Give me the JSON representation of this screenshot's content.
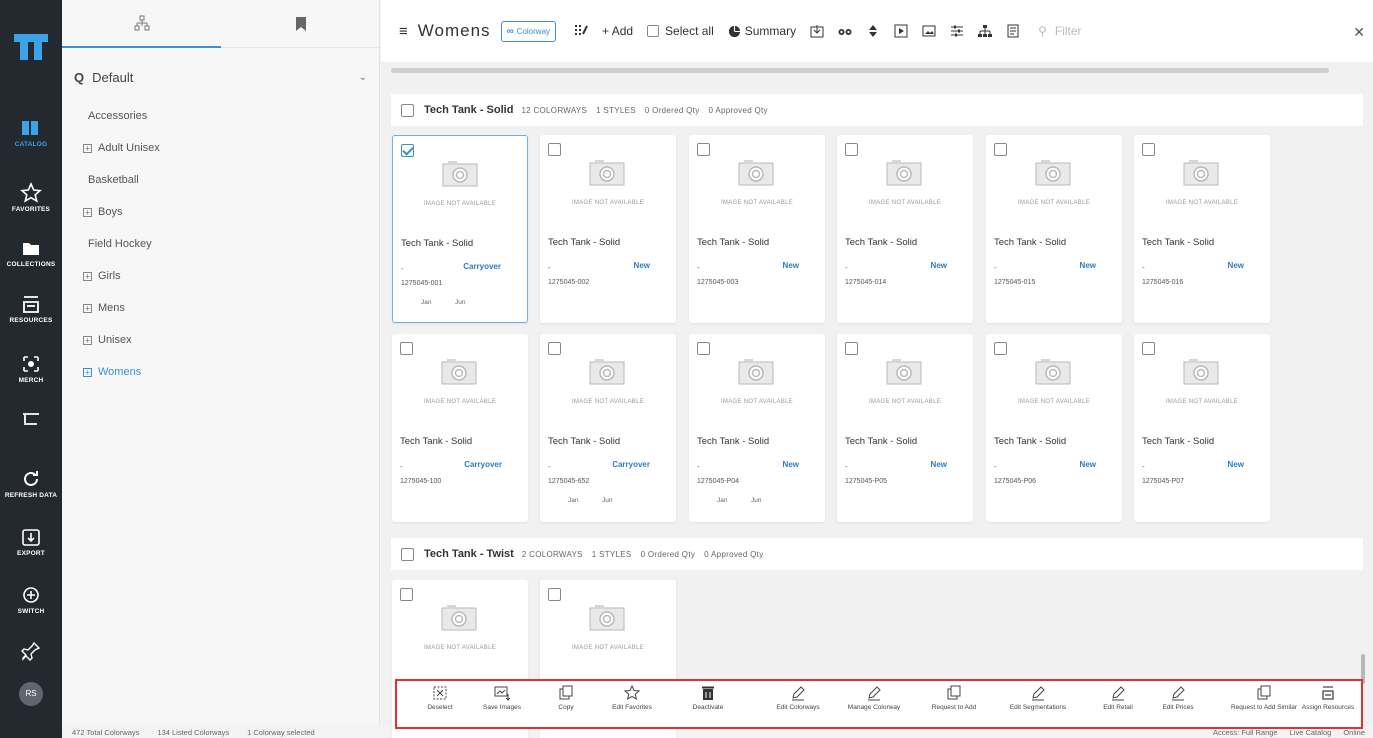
{
  "rail": {
    "items": [
      {
        "label": "CATALOG",
        "icon": "catalog-icon"
      },
      {
        "label": "FAVORITES",
        "icon": "star-icon"
      },
      {
        "label": "COLLECTIONS",
        "icon": "folder-icon"
      },
      {
        "label": "RESOURCES",
        "icon": "resources-icon"
      },
      {
        "label": "MERCH",
        "icon": "merch-icon"
      },
      {
        "label": "",
        "icon": "cart-icon"
      },
      {
        "label": "REFRESH DATA",
        "icon": "refresh-icon"
      },
      {
        "label": "EXPORT",
        "icon": "export-icon"
      },
      {
        "label": "SWITCH",
        "icon": "switch-icon"
      },
      {
        "label": "",
        "icon": "pin-icon"
      }
    ],
    "avatar": "RS"
  },
  "sidebar": {
    "view_select": "Default",
    "tree": [
      {
        "label": "Accessories",
        "expandable": false
      },
      {
        "label": "Adult Unisex",
        "expandable": true
      },
      {
        "label": "Basketball",
        "expandable": false
      },
      {
        "label": "Boys",
        "expandable": true
      },
      {
        "label": "Field Hockey",
        "expandable": false
      },
      {
        "label": "Girls",
        "expandable": true
      },
      {
        "label": "Mens",
        "expandable": true
      },
      {
        "label": "Unisex",
        "expandable": true
      },
      {
        "label": "Womens",
        "expandable": true,
        "selected": true
      }
    ]
  },
  "toolbar": {
    "title": "Womens",
    "colorway_pill": "Colorway",
    "add_label": "+ Add",
    "select_all_label": "Select all",
    "summary_label": "Summary",
    "filter_placeholder": "Filter"
  },
  "groups": [
    {
      "name": "Tech Tank - Solid",
      "colorways": "12 COLORWAYS",
      "styles": "1 STYLES",
      "ordered": "0 Ordered Qty",
      "approved": "0 Approved Qty",
      "cards": [
        {
          "name": "Tech Tank - Solid",
          "dash": "-",
          "status": "Carryover",
          "code": "1275045-001",
          "m1": "Jan",
          "m2": "Jun",
          "selected": true,
          "no_image": "IMAGE NOT AVAILABLE"
        },
        {
          "name": "Tech Tank - Solid",
          "dash": "-",
          "status": "New",
          "code": "1275045-002",
          "m1": "",
          "m2": "",
          "selected": false,
          "no_image": "IMAGE NOT AVAILABLE"
        },
        {
          "name": "Tech Tank - Solid",
          "dash": "-",
          "status": "New",
          "code": "1275045-003",
          "m1": "",
          "m2": "",
          "selected": false,
          "no_image": "IMAGE NOT AVAILABLE"
        },
        {
          "name": "Tech Tank - Solid",
          "dash": "-",
          "status": "New",
          "code": "1275045-014",
          "m1": "",
          "m2": "",
          "selected": false,
          "no_image": "IMAGE NOT AVAILABLE"
        },
        {
          "name": "Tech Tank - Solid",
          "dash": "-",
          "status": "New",
          "code": "1275045-015",
          "m1": "",
          "m2": "",
          "selected": false,
          "no_image": "IMAGE NOT AVAILABLE"
        },
        {
          "name": "Tech Tank - Solid",
          "dash": "-",
          "status": "New",
          "code": "1275045-016",
          "m1": "",
          "m2": "",
          "selected": false,
          "no_image": "IMAGE NOT AVAILABLE"
        },
        {
          "name": "Tech Tank - Solid",
          "dash": "-",
          "status": "Carryover",
          "code": "1275045-100",
          "m1": "",
          "m2": "",
          "selected": false,
          "no_image": "IMAGE NOT AVAILABLE"
        },
        {
          "name": "Tech Tank - Solid",
          "dash": "-",
          "status": "Carryover",
          "code": "1275045-652",
          "m1": "Jan",
          "m2": "Jun",
          "selected": false,
          "no_image": "IMAGE NOT AVAILABLE"
        },
        {
          "name": "Tech Tank - Solid",
          "dash": "-",
          "status": "New",
          "code": "1275045-P04",
          "m1": "Jan",
          "m2": "Jun",
          "selected": false,
          "no_image": "IMAGE NOT AVAILABLE"
        },
        {
          "name": "Tech Tank - Solid",
          "dash": "-",
          "status": "New",
          "code": "1275045-P05",
          "m1": "",
          "m2": "",
          "selected": false,
          "no_image": "IMAGE NOT AVAILABLE"
        },
        {
          "name": "Tech Tank - Solid",
          "dash": "-",
          "status": "New",
          "code": "1275045-P06",
          "m1": "",
          "m2": "",
          "selected": false,
          "no_image": "IMAGE NOT AVAILABLE"
        },
        {
          "name": "Tech Tank - Solid",
          "dash": "-",
          "status": "New",
          "code": "1275045-P07",
          "m1": "",
          "m2": "",
          "selected": false,
          "no_image": "IMAGE NOT AVAILABLE"
        }
      ]
    },
    {
      "name": "Tech Tank - Twist",
      "colorways": "2 COLORWAYS",
      "styles": "1 STYLES",
      "ordered": "0 Ordered Qty",
      "approved": "0 Approved Qty",
      "cards": [
        {
          "name": "",
          "dash": "",
          "status": "",
          "code": "",
          "m1": "",
          "m2": "",
          "selected": false,
          "no_image": "IMAGE NOT AVAILABLE"
        },
        {
          "name": "",
          "dash": "",
          "status": "",
          "code": "",
          "m1": "",
          "m2": "",
          "selected": false,
          "no_image": "IMAGE NOT AVAILABLE"
        }
      ]
    }
  ],
  "actions": [
    {
      "label": "Deselect",
      "icon": "deselect-icon"
    },
    {
      "label": "Save Images",
      "icon": "save-images-icon"
    },
    {
      "label": "Copy",
      "icon": "copy-icon"
    },
    {
      "label": "Edit Favorites",
      "icon": "star-icon"
    },
    {
      "label": "Deactivate",
      "icon": "trash-icon"
    },
    {
      "label": "Edit Colorways",
      "icon": "pencil-icon"
    },
    {
      "label": "Manage Colorway",
      "icon": "pencil-icon"
    },
    {
      "label": "Request to Add",
      "icon": "copy-icon"
    },
    {
      "label": "Edit Segmentations",
      "icon": "pencil-icon"
    },
    {
      "label": "Edit Retail",
      "icon": "pencil-icon"
    },
    {
      "label": "Edit Prices",
      "icon": "pencil-icon"
    },
    {
      "label": "Request to Add Similar",
      "icon": "copy-icon"
    },
    {
      "label": "Assign Resources",
      "icon": "resources-icon"
    }
  ],
  "status": {
    "total": "472 Total Colorways",
    "listed": "134 Listed Colorways",
    "selected": "1 Colorway selected",
    "access": "Access: Full Range",
    "mode": "Live Catalog",
    "online": "Online"
  },
  "colors": {
    "rail_bg": "#24292f",
    "accent": "#3a8fd6",
    "highlight_border": "#e0332e"
  }
}
